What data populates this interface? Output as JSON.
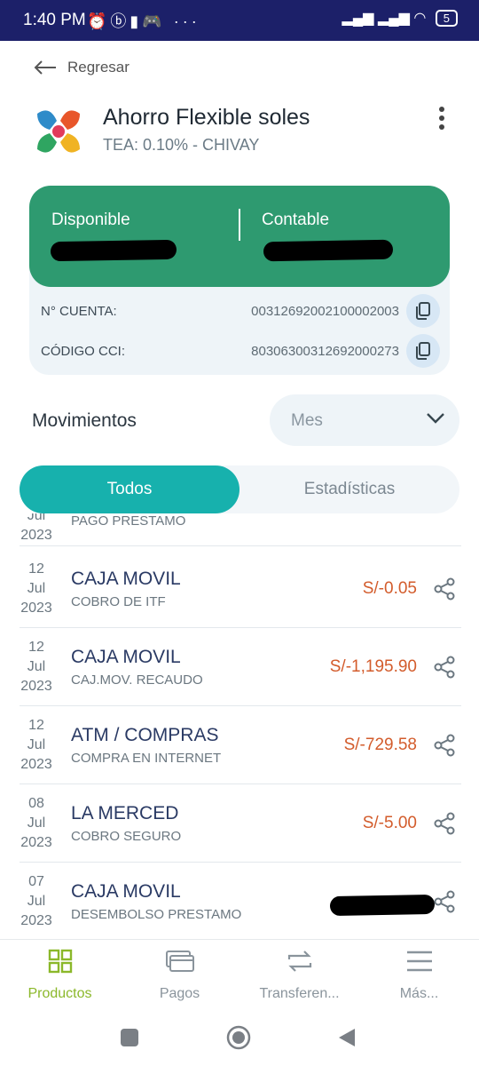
{
  "status_bar": {
    "time": "1:40 PM",
    "battery": "5"
  },
  "header": {
    "back_label": "Regresar",
    "title": "Ahorro Flexible soles",
    "subtitle": "TEA: 0.10% - CHIVAY"
  },
  "balance_card": {
    "available_label": "Disponible",
    "accounting_label": "Contable"
  },
  "account": {
    "number_label": "N° CUENTA:",
    "number_value": "00312692002100002003",
    "cci_label": "CÓDIGO CCI:",
    "cci_value": "80306300312692000273"
  },
  "movements": {
    "label": "Movimientos",
    "period_selected": "Mes"
  },
  "tabs": {
    "all": "Todos",
    "stats": "Estadísticas"
  },
  "transactions": [
    {
      "day": "",
      "month": "Jul",
      "year": "2023",
      "title": "",
      "desc": "PAGO PRESTAMO",
      "amount": ""
    },
    {
      "day": "12",
      "month": "Jul",
      "year": "2023",
      "title": "CAJA MOVIL",
      "desc": "COBRO DE ITF",
      "amount": "S/-0.05"
    },
    {
      "day": "12",
      "month": "Jul",
      "year": "2023",
      "title": "CAJA MOVIL",
      "desc": "CAJ.MOV. RECAUDO",
      "amount": "S/-1,195.90"
    },
    {
      "day": "12",
      "month": "Jul",
      "year": "2023",
      "title": "ATM / COMPRAS",
      "desc": "COMPRA EN INTERNET",
      "amount": "S/-729.58"
    },
    {
      "day": "08",
      "month": "Jul",
      "year": "2023",
      "title": "LA MERCED",
      "desc": "COBRO SEGURO",
      "amount": "S/-5.00"
    },
    {
      "day": "07",
      "month": "Jul",
      "year": "2023",
      "title": "CAJA MOVIL",
      "desc": "DESEMBOLSO PRESTAMO",
      "amount": ""
    }
  ],
  "bottom_nav": {
    "products": "Productos",
    "payments": "Pagos",
    "transfers": "Transferen...",
    "more": "Más..."
  },
  "colors": {
    "accent_green": "#2e9a70",
    "tab_teal": "#17b1ad",
    "amount_negative": "#d35c2c",
    "nav_active": "#8bb82a",
    "status_bar": "#1c2069"
  }
}
